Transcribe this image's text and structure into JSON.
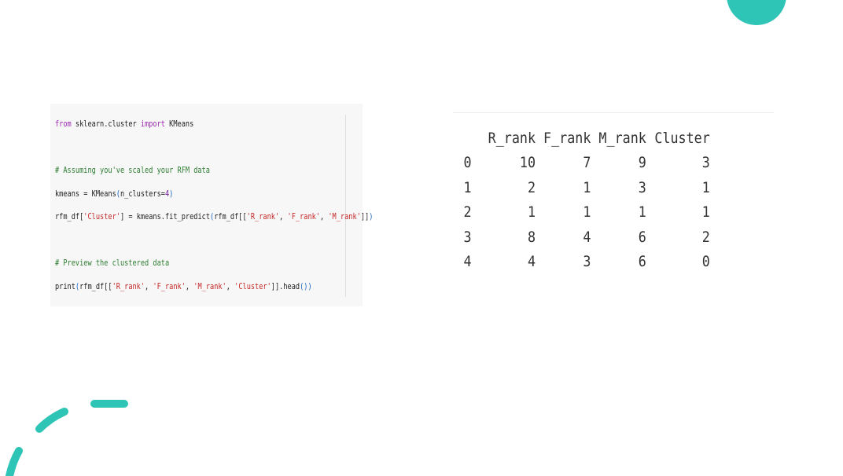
{
  "colors": {
    "accent": "#2ec4b6",
    "keyword": "#9c27b0",
    "comment": "#2e7d32",
    "string": "#c62828"
  },
  "code": {
    "line1": {
      "kw1": "from",
      "mod": " sklearn.cluster ",
      "kw2": "import",
      "name": " KMeans"
    },
    "line2": {
      "comment": "# Assuming you've scaled your RFM data"
    },
    "line3": {
      "a": "kmeans = KMeans",
      "p1": "(",
      "b": "n_clusters=",
      "n": "4",
      "p2": ")"
    },
    "line4": {
      "a": "rfm_df[",
      "s1": "'Cluster'",
      "b": "] = kmeans.fit_predict",
      "p1": "(",
      "c": "rfm_df[[",
      "s2": "'R_rank'",
      "d": ", ",
      "s3": "'F_rank'",
      "e": ", ",
      "s4": "'M_rank'",
      "f": "]]",
      "p2": ")"
    },
    "line5": {
      "comment": "# Preview the clustered data"
    },
    "line6": {
      "a": "print",
      "p1": "(",
      "b": "rfm_df[[",
      "s1": "'R_rank'",
      "c": ", ",
      "s2": "'F_rank'",
      "d": ", ",
      "s3": "'M_rank'",
      "e": ", ",
      "s4": "'Cluster'",
      "f": "]].head",
      "p2": "()",
      "p3": ")"
    }
  },
  "output": {
    "headers": [
      "",
      "R_rank",
      "F_rank",
      "M_rank",
      "Cluster"
    ],
    "rows": [
      [
        "0",
        "10",
        "7",
        "9",
        "3"
      ],
      [
        "1",
        "2",
        "1",
        "3",
        "1"
      ],
      [
        "2",
        "1",
        "1",
        "1",
        "1"
      ],
      [
        "3",
        "8",
        "4",
        "6",
        "2"
      ],
      [
        "4",
        "4",
        "3",
        "6",
        "0"
      ]
    ]
  }
}
